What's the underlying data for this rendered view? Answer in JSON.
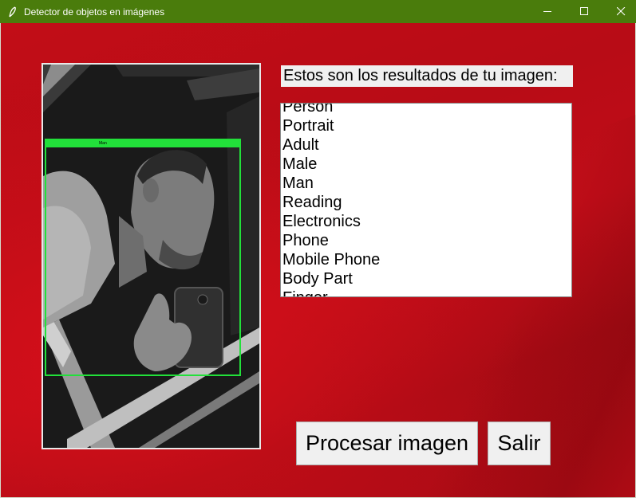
{
  "window": {
    "title": "Detector de objetos en imágenes",
    "controls": {
      "minimize_icon": "minimize-icon",
      "maximize_icon": "maximize-icon",
      "close_icon": "close-icon"
    }
  },
  "image_panel": {
    "detection_box": {
      "label": "Man",
      "color": "#22e03a"
    }
  },
  "results": {
    "heading": "Estos son los resultados de tu imagen:",
    "items": [
      "Person",
      "Portrait",
      "Adult",
      "Male",
      "Man",
      "Reading",
      "Electronics",
      "Phone",
      "Mobile Phone",
      "Body Part",
      "Finger"
    ]
  },
  "buttons": {
    "process_label": "Procesar imagen",
    "exit_label": "Salir"
  },
  "colors": {
    "titlebar": "#4a7c0c",
    "background": "#c20d17",
    "button_face": "#f0f0f0"
  }
}
